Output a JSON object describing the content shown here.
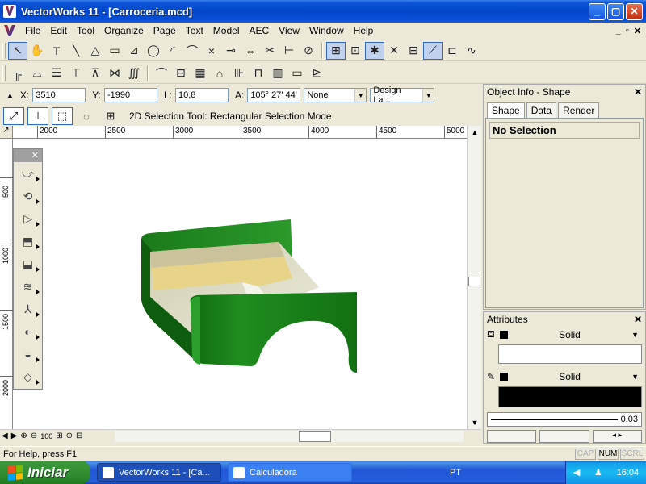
{
  "window": {
    "title": "VectorWorks 11 - [Carroceria.mcd]",
    "min": "_",
    "max": "▢",
    "close": "✕"
  },
  "menubar": {
    "items": [
      "File",
      "Edit",
      "Tool",
      "Organize",
      "Page",
      "Text",
      "Model",
      "AEC",
      "View",
      "Window",
      "Help"
    ],
    "mdi_min": "_",
    "mdi_restore": "▫",
    "mdi_close": "✕"
  },
  "databar": {
    "x_label": "X:",
    "x_value": "3510",
    "y_label": "Y:",
    "y_value": "-1990",
    "l_label": "L:",
    "l_value": "10,8",
    "a_label": "A:",
    "a_value": "105° 27' 44''",
    "class_value": "None",
    "layer_value": "Design La..."
  },
  "modebar": {
    "text": "2D Selection Tool: Rectangular Selection Mode"
  },
  "ruler": {
    "h_ticks": [
      "2000",
      "2500",
      "3000",
      "3500",
      "4000",
      "4500",
      "5000"
    ],
    "v_ticks": [
      "500",
      "1000",
      "1500",
      "2000"
    ]
  },
  "zoom": {
    "level": "100"
  },
  "object_info": {
    "title": "Object Info - Shape",
    "tabs": [
      "Shape",
      "Data",
      "Render"
    ],
    "selection": "No Selection"
  },
  "attributes": {
    "title": "Attributes",
    "fill_style": "Solid",
    "pen_style": "Solid",
    "line_weight": "0,03"
  },
  "status": {
    "help": "For Help, press F1",
    "caps": "CAP",
    "num": "NUM",
    "scrl": "SCRL"
  },
  "taskbar": {
    "start": "Iniciar",
    "tasks": [
      "VectorWorks 11 - [Ca...",
      "Calculadora"
    ],
    "lang": "PT",
    "clock": "16:04"
  },
  "colors": {
    "body_green": "#1f8a1f",
    "body_dark": "#0f5a0f",
    "bed_cream": "#e8d488",
    "floor": "#ddddc8"
  }
}
